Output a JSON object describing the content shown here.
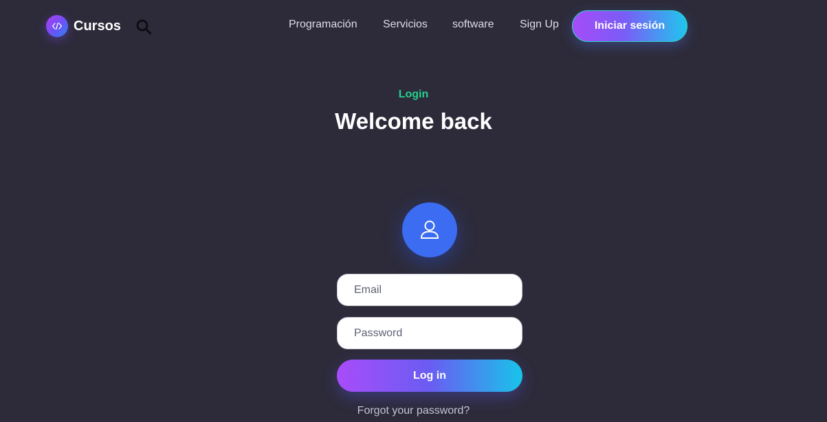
{
  "header": {
    "brand": {
      "name": "Cursos",
      "logo_icon": "code-icon"
    },
    "search_icon": "search-icon",
    "nav": [
      "Programación",
      "Servicios",
      "software",
      "Sign Up"
    ],
    "cta_label": "Iniciar sesión"
  },
  "hero": {
    "eyebrow": "Login",
    "title": "Welcome back"
  },
  "form": {
    "avatar_icon": "user-icon",
    "email_placeholder": "Email",
    "password_placeholder": "Password",
    "submit_label": "Log in",
    "forgot_label": "Forgot your password?"
  },
  "colors": {
    "background": "#2d2b3a",
    "accent_green": "#23d28e",
    "avatar_blue": "#3c6cf2",
    "gradient_start": "#a94cf9",
    "gradient_end": "#18c4ea"
  }
}
